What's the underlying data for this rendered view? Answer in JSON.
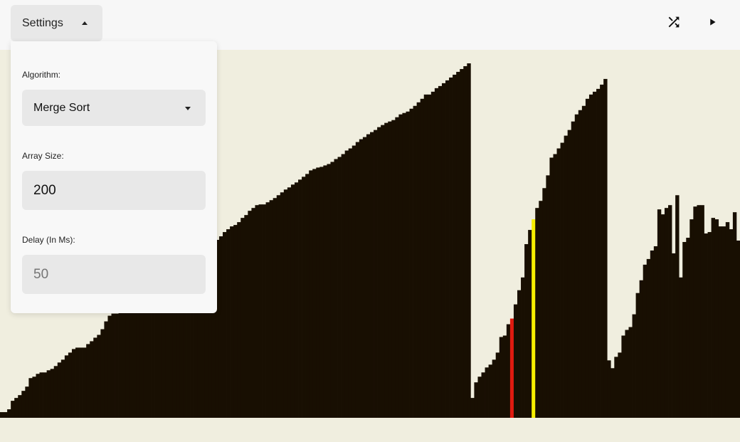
{
  "toolbar": {
    "settings_label": "Settings",
    "shuffle_icon": "shuffle-icon",
    "play_icon": "play-icon"
  },
  "settings_panel": {
    "algorithm_label": "Algorithm:",
    "algorithm_value": "Merge Sort",
    "array_size_label": "Array Size:",
    "array_size_value": "200",
    "delay_label": "Delay (In Ms):",
    "delay_placeholder": "50"
  },
  "colors": {
    "bar": "#180f02",
    "compare_a": "#e01b10",
    "compare_b": "#f6ee00",
    "background": "#f0eedf",
    "topbar": "#f7f7f7"
  },
  "chart_data": {
    "type": "bar",
    "array_size": 200,
    "ylim": [
      0,
      500
    ],
    "highlight": {
      "compare_a_index": 142,
      "compare_b_index": 148
    },
    "values": [
      8,
      8,
      12,
      24,
      28,
      32,
      38,
      44,
      56,
      58,
      62,
      64,
      64,
      67,
      69,
      73,
      78,
      82,
      88,
      92,
      97,
      99,
      99,
      99,
      104,
      108,
      113,
      117,
      125,
      136,
      144,
      147,
      147,
      150,
      155,
      157,
      159,
      162,
      164,
      166,
      168,
      173,
      177,
      180,
      186,
      190,
      195,
      199,
      203,
      206,
      210,
      215,
      218,
      222,
      226,
      230,
      234,
      238,
      240,
      246,
      251,
      256,
      262,
      266,
      270,
      272,
      276,
      282,
      286,
      292,
      296,
      300,
      301,
      301,
      304,
      307,
      310,
      314,
      318,
      322,
      325,
      329,
      332,
      336,
      340,
      344,
      349,
      351,
      353,
      354,
      356,
      358,
      361,
      365,
      368,
      372,
      377,
      380,
      384,
      389,
      393,
      396,
      400,
      403,
      406,
      410,
      413,
      416,
      418,
      420,
      424,
      428,
      430,
      432,
      436,
      440,
      445,
      450,
      456,
      456,
      460,
      465,
      468,
      472,
      476,
      480,
      484,
      488,
      492,
      496,
      500,
      28,
      50,
      58,
      64,
      71,
      75,
      82,
      92,
      114,
      116,
      132,
      140,
      160,
      180,
      198,
      245,
      265,
      280,
      296,
      306,
      324,
      342,
      367,
      372,
      380,
      388,
      398,
      406,
      418,
      428,
      434,
      440,
      450,
      456,
      460,
      464,
      470,
      478,
      81,
      70,
      86,
      92,
      116,
      124,
      128,
      146,
      176,
      194,
      216,
      224,
      236,
      242,
      294,
      287,
      296,
      300,
      232,
      314,
      198,
      248,
      254,
      280,
      298,
      300,
      300,
      260,
      262,
      282,
      280,
      270,
      270,
      276,
      266,
      290,
      250
    ]
  }
}
